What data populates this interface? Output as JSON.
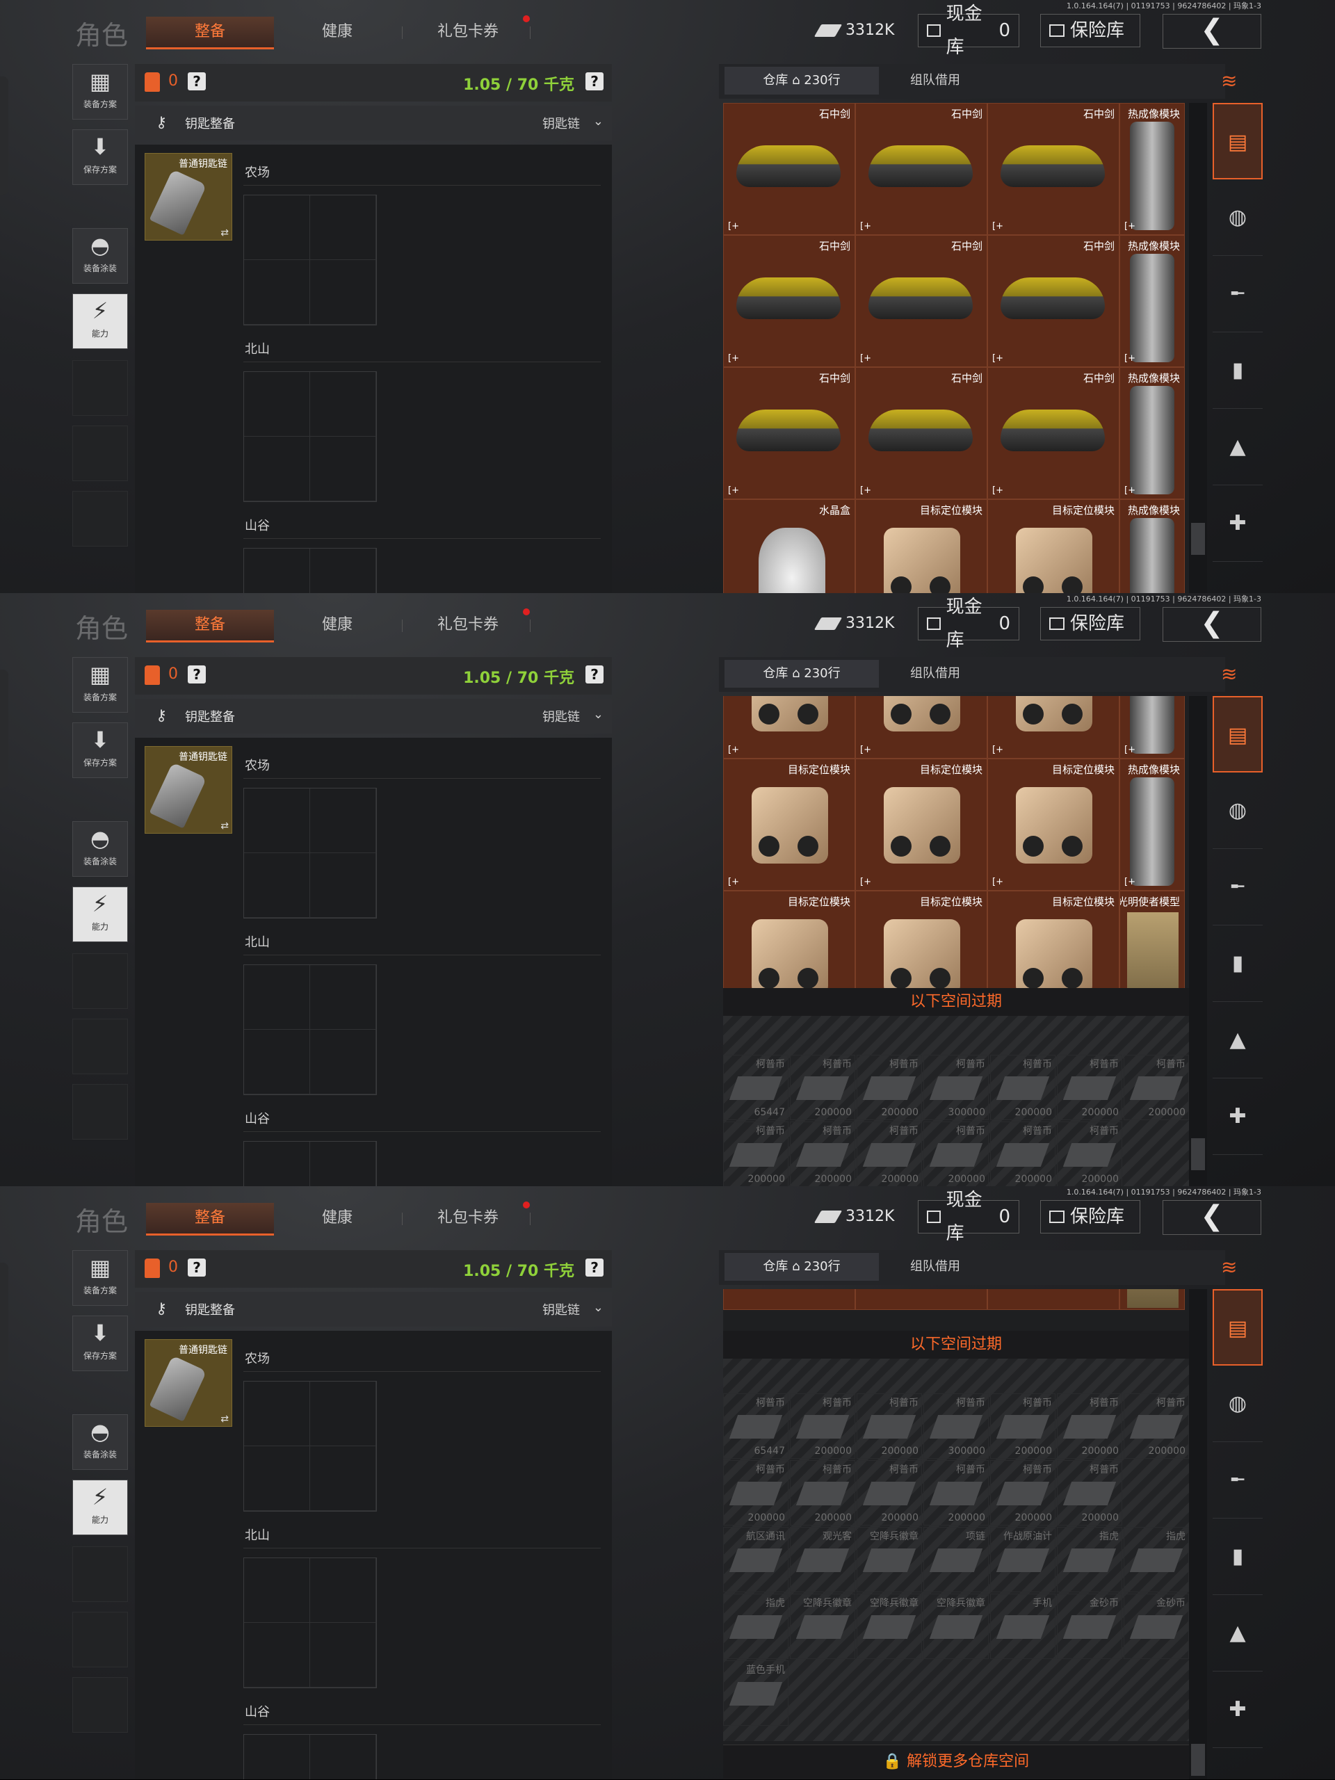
{
  "version": "1.0.164.164(7) | 01191753 | 9624786402 | 玛象1-3",
  "header": {
    "title": "角色",
    "tabs": [
      {
        "label": "整备",
        "active": true
      },
      {
        "label": "健康",
        "active": false
      },
      {
        "label": "礼包卡券",
        "active": false,
        "has_notification": true
      }
    ],
    "currency": "3312K",
    "cash_vault_label": "现金库",
    "cash_vault_count": "0",
    "safe_label": "保险库",
    "back_symbol": "❮"
  },
  "side": {
    "buttons": [
      {
        "label": "装备方案",
        "icon": "vest-icon"
      },
      {
        "label": "保存方案",
        "icon": "download-icon"
      },
      {
        "label": "装备涂装",
        "icon": "helmet-paint-icon"
      },
      {
        "label": "能力",
        "icon": "ability-icon"
      }
    ]
  },
  "loadout": {
    "bag_count": "0",
    "help": "?",
    "weight": "1.05 / 70 千克",
    "section_title": "钥匙整备",
    "section_selector": "钥匙链",
    "keychain_name": "普通钥匙链",
    "swap_symbol": "⇄",
    "areas": [
      "农场",
      "北山",
      "山谷"
    ]
  },
  "warehouse": {
    "tab_storage": "仓库",
    "rows_label": "230行",
    "tab_team": "组队借用",
    "expired_label": "以下空间过期",
    "unlock_label": "🔒 解锁更多仓库空间",
    "item_names": {
      "sword": "石中剑",
      "thermal": "热成像模块",
      "crystal": "水晶盒",
      "target": "目标定位模块",
      "model": "光明使者模型"
    },
    "marker": "[+",
    "expired_items": {
      "row1": [
        {
          "name": "柯普币",
          "value": "65447"
        },
        {
          "name": "柯普币",
          "value": "200000"
        },
        {
          "name": "柯普币",
          "value": "200000"
        },
        {
          "name": "柯普币",
          "value": "300000"
        },
        {
          "name": "柯普币",
          "value": "200000"
        },
        {
          "name": "柯普币",
          "value": "200000"
        },
        {
          "name": "柯普币",
          "value": "200000"
        }
      ],
      "row2": [
        {
          "name": "柯普币",
          "value": "200000"
        },
        {
          "name": "柯普币",
          "value": "200000"
        },
        {
          "name": "柯普币",
          "value": "200000"
        },
        {
          "name": "柯普币",
          "value": "200000"
        },
        {
          "name": "柯普币",
          "value": "200000"
        },
        {
          "name": "柯普币",
          "value": "200000"
        }
      ],
      "row3": [
        {
          "name": "航区通讯",
          "value": ""
        },
        {
          "name": "观光客",
          "value": ""
        },
        {
          "name": "空降兵徽章",
          "value": ""
        },
        {
          "name": "项链",
          "value": ""
        },
        {
          "name": "作战原油计",
          "value": ""
        },
        {
          "name": "指虎",
          "value": ""
        },
        {
          "name": "指虎",
          "value": ""
        }
      ],
      "row4": [
        {
          "name": "指虎",
          "value": ""
        },
        {
          "name": "空降兵徽章",
          "value": ""
        },
        {
          "name": "空降兵徽章",
          "value": ""
        },
        {
          "name": "空降兵徽章",
          "value": ""
        },
        {
          "name": "手机",
          "value": ""
        },
        {
          "name": "金砂币",
          "value": ""
        },
        {
          "name": "金砂币",
          "value": ""
        }
      ],
      "row5": [
        {
          "name": "蓝色手机",
          "value": ""
        }
      ]
    }
  },
  "colors": {
    "accent": "#e8602a",
    "weight": "#8fd13a",
    "cell": "#5c2a18"
  }
}
